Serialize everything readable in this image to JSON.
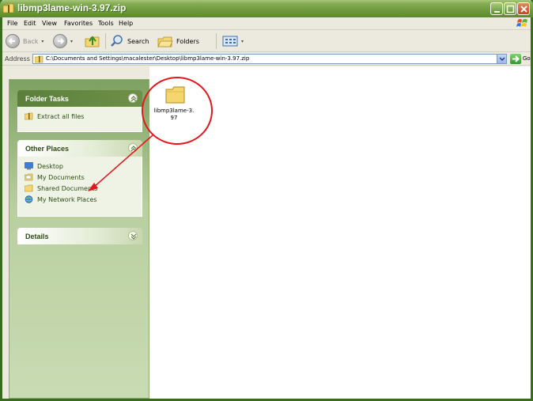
{
  "window": {
    "title": "libmp3lame-win-3.97.zip"
  },
  "menu": [
    "File",
    "Edit",
    "View",
    "Favorites",
    "Tools",
    "Help"
  ],
  "toolbar": {
    "back_label": "Back",
    "search_label": "Search",
    "folders_label": "Folders"
  },
  "address": {
    "label": "Address",
    "path": "C:\\Documents and Settings\\macalester\\Desktop\\libmp3lame-win-3.97.zip",
    "go_label": "Go"
  },
  "taskpane": {
    "folder_tasks": {
      "title": "Folder Tasks",
      "items": [
        "Extract all files"
      ]
    },
    "other_places": {
      "title": "Other Places",
      "items": [
        "Desktop",
        "My Documents",
        "Shared Documents",
        "My Network Places"
      ]
    },
    "details": {
      "title": "Details"
    }
  },
  "files": [
    {
      "name_line1": "libmp3lame-3.",
      "name_line2": "97"
    }
  ],
  "colors": {
    "titlebar": "#6f9a3c",
    "annotation_red": "#e8141c",
    "folder_yellow": "#f5d66e"
  }
}
